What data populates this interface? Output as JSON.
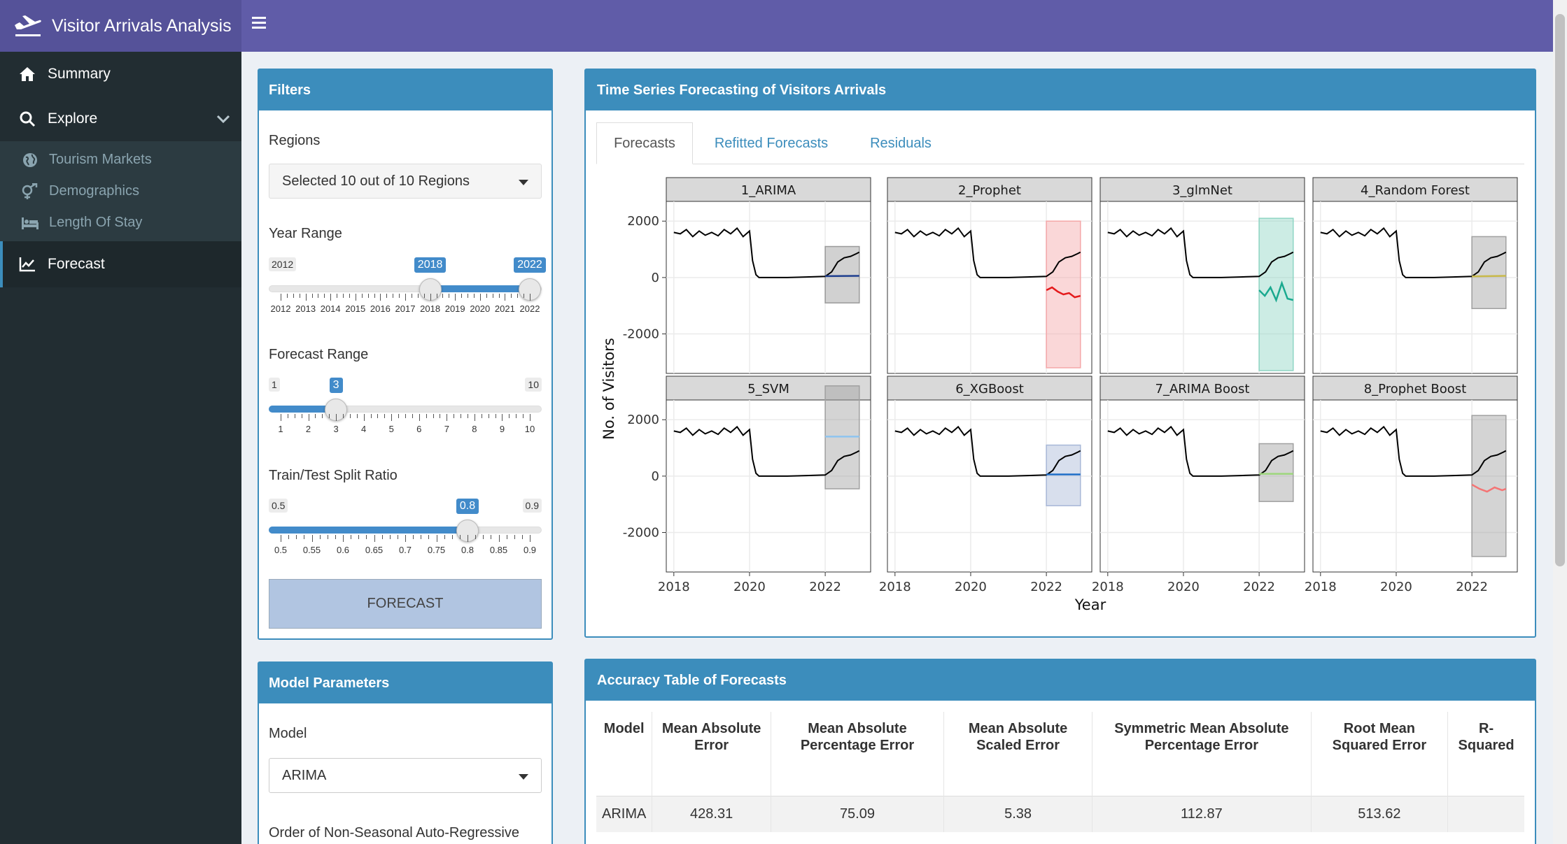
{
  "app": {
    "title": "Visitor Arrivals Analysis"
  },
  "sidebar": {
    "items": [
      {
        "label": "Summary",
        "icon": "home-icon"
      },
      {
        "label": "Explore",
        "icon": "search-icon"
      }
    ],
    "sub_items": [
      {
        "label": "Tourism Markets",
        "icon": "globe-icon"
      },
      {
        "label": "Demographics",
        "icon": "venus-mars-icon"
      },
      {
        "label": "Length Of Stay",
        "icon": "bed-icon"
      }
    ],
    "active": {
      "label": "Forecast",
      "icon": "line-chart-icon"
    }
  },
  "filters": {
    "title": "Filters",
    "regions_label": "Regions",
    "regions_value": "Selected 10 out of 10 Regions",
    "year_range": {
      "label": "Year Range",
      "min": "2012",
      "max": "2022",
      "from": "2018",
      "to": "2022",
      "min_value": 2012,
      "max_value": 2022,
      "from_value": 2018,
      "to_value": 2022,
      "ticks": [
        "2012",
        "2013",
        "2014",
        "2015",
        "2016",
        "2017",
        "2018",
        "2019",
        "2020",
        "2021",
        "2022"
      ]
    },
    "forecast_range": {
      "label": "Forecast Range",
      "min": "1",
      "max": "10",
      "value": "3",
      "min_value": 1,
      "max_value": 10,
      "current": 3,
      "ticks": [
        "1",
        "2",
        "3",
        "4",
        "5",
        "6",
        "7",
        "8",
        "9",
        "10"
      ]
    },
    "split": {
      "label": "Train/Test Split Ratio",
      "min": "0.5",
      "max": "0.9",
      "value": "0.8",
      "min_value": 0.5,
      "max_value": 0.9,
      "current": 0.8,
      "ticks": [
        "0.5",
        "0.55",
        "0.6",
        "0.65",
        "0.7",
        "0.75",
        "0.8",
        "0.85",
        "0.9"
      ]
    },
    "button": "FORECAST"
  },
  "model_params": {
    "title": "Model Parameters",
    "model_label": "Model",
    "model_value": "ARIMA",
    "order_label": "Order of Non-Seasonal Auto-Regressive"
  },
  "forecast_panel": {
    "title": "Time Series Forecasting of Visitors Arrivals",
    "tabs": [
      "Forecasts",
      "Refitted Forecasts",
      "Residuals"
    ],
    "active_tab": "Forecasts"
  },
  "chart_data": {
    "type": "line",
    "facets": [
      "1_ARIMA",
      "2_Prophet",
      "3_glmNet",
      "4_Random Forest",
      "5_SVM",
      "6_XGBoost",
      "7_ARIMA Boost",
      "8_Prophet Boost"
    ],
    "xlabel": "Year",
    "ylabel": "No. of Visitors",
    "xlim": [
      2017.8,
      2023.2
    ],
    "ylim": [
      -3400,
      2700
    ],
    "x_ticks": [
      "2018",
      "2020",
      "2022"
    ],
    "y_ticks": [
      "2000",
      "0",
      "-2000"
    ],
    "actual_series": {
      "name": "actual",
      "color": "#000000",
      "x": [
        2018.0,
        2018.17,
        2018.33,
        2018.5,
        2018.67,
        2018.83,
        2019.0,
        2019.17,
        2019.33,
        2019.5,
        2019.67,
        2019.83,
        2020.0,
        2020.08,
        2020.17,
        2020.25,
        2020.5,
        2021.0,
        2021.5,
        2022.0,
        2022.17,
        2022.33,
        2022.5,
        2022.67,
        2022.83,
        2022.9
      ],
      "y": [
        1600,
        1550,
        1700,
        1450,
        1650,
        1500,
        1600,
        1480,
        1700,
        1550,
        1750,
        1450,
        1650,
        600,
        100,
        0,
        0,
        0,
        20,
        40,
        200,
        550,
        700,
        750,
        850,
        900
      ]
    },
    "forecasts": [
      {
        "name": "1_ARIMA",
        "color": "#1f3f8f",
        "band": "#9a9a9a",
        "x": [
          2022.0,
          2022.9
        ],
        "y": [
          50,
          60
        ],
        "lower": [
          -900,
          -900
        ],
        "upper": [
          1100,
          1100
        ]
      },
      {
        "name": "2_Prophet",
        "color": "#e41a1c",
        "band": "#f4a7a8",
        "x": [
          2022.0,
          2022.15,
          2022.3,
          2022.45,
          2022.6,
          2022.75,
          2022.9
        ],
        "y": [
          -450,
          -350,
          -500,
          -600,
          -550,
          -700,
          -650
        ],
        "lower": [
          -3200,
          -3200,
          -3200,
          -3200,
          -3200,
          -3200,
          -3200
        ],
        "upper": [
          2000,
          2000,
          2000,
          2000,
          2000,
          2000,
          2000
        ]
      },
      {
        "name": "3_glmNet",
        "color": "#1aa98f",
        "band": "#8fd5c4",
        "x": [
          2022.0,
          2022.15,
          2022.3,
          2022.45,
          2022.6,
          2022.75,
          2022.9
        ],
        "y": [
          -450,
          -650,
          -350,
          -800,
          -200,
          -750,
          -800
        ],
        "lower": [
          -3300,
          -3300,
          -3300,
          -3300,
          -3300,
          -3300,
          -3300
        ],
        "upper": [
          2100,
          2100,
          2100,
          2100,
          2100,
          2100,
          2100
        ]
      },
      {
        "name": "4_Random Forest",
        "color": "#c8b94a",
        "band": "#a0a0a0",
        "x": [
          2022.0,
          2022.9
        ],
        "y": [
          40,
          60
        ],
        "lower": [
          -1100,
          -1100
        ],
        "upper": [
          1450,
          1450
        ]
      },
      {
        "name": "5_SVM",
        "color": "#8ec5f0",
        "band": "#a0a0a0",
        "x": [
          2022.0,
          2022.9
        ],
        "y": [
          1400,
          1400
        ],
        "lower": [
          -450,
          -450
        ],
        "upper": [
          3200,
          3200
        ]
      },
      {
        "name": "6_XGBoost",
        "color": "#1f6fc8",
        "band": "#a8b8d8",
        "x": [
          2022.0,
          2022.9
        ],
        "y": [
          60,
          60
        ],
        "lower": [
          -1050,
          -1050
        ],
        "upper": [
          1100,
          1100
        ]
      },
      {
        "name": "7_ARIMA Boost",
        "color": "#9dd67c",
        "band": "#a0a0a0",
        "x": [
          2022.0,
          2022.9
        ],
        "y": [
          80,
          80
        ],
        "lower": [
          -900,
          -900
        ],
        "upper": [
          1150,
          1150
        ]
      },
      {
        "name": "8_Prophet Boost",
        "color": "#f47575",
        "band": "#a0a0a0",
        "x": [
          2022.0,
          2022.2,
          2022.4,
          2022.6,
          2022.8,
          2022.9
        ],
        "y": [
          -300,
          -450,
          -550,
          -400,
          -500,
          -450
        ],
        "lower": [
          -2850,
          -2850,
          -2850,
          -2850,
          -2850,
          -2850
        ],
        "upper": [
          2150,
          2150,
          2150,
          2150,
          2150,
          2150
        ]
      }
    ]
  },
  "accuracy": {
    "title": "Accuracy Table of Forecasts",
    "columns": [
      "Model",
      "Mean Absolute Error",
      "Mean Absolute Percentage Error",
      "Mean Absolute Scaled Error",
      "Symmetric Mean Absolute Percentage Error",
      "Root Mean Squared Error",
      "R-Squared"
    ],
    "rows": [
      [
        "ARIMA",
        "428.31",
        "75.09",
        "5.38",
        "112.87",
        "513.62",
        ""
      ]
    ]
  },
  "colors": {
    "header": "#605ca8",
    "brand": "#555299",
    "sidebar": "#222d32",
    "box": "#3c8dbc"
  }
}
